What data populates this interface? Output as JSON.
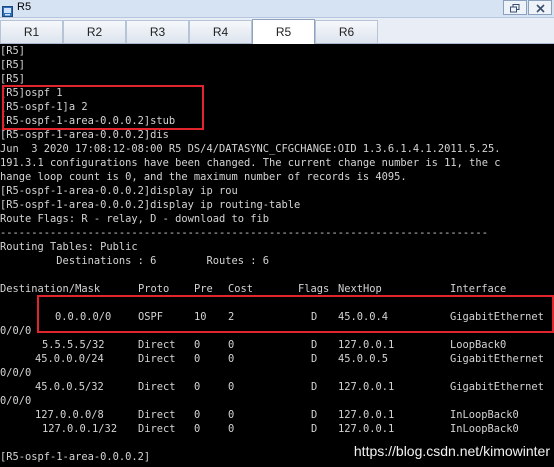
{
  "window": {
    "title": "R5",
    "icon": "router-terminal-icon",
    "buttons": [
      "restore-icon",
      "close-icon"
    ]
  },
  "tabs": [
    {
      "label": "R1",
      "active": false
    },
    {
      "label": "R2",
      "active": false
    },
    {
      "label": "R3",
      "active": false
    },
    {
      "label": "R4",
      "active": false
    },
    {
      "label": "R5",
      "active": true
    },
    {
      "label": "R6",
      "active": false
    }
  ],
  "terminal": {
    "lines": [
      "[R5]",
      "[R5]",
      "[R5]",
      "[R5]ospf 1",
      "[R5-ospf-1]a 2",
      "[R5-ospf-1-area-0.0.0.2]stub",
      "[R5-ospf-1-area-0.0.0.2]dis",
      "Jun  3 2020 17:08:12-08:00 R5 DS/4/DATASYNC_CFGCHANGE:OID 1.3.6.1.4.1.2011.5.25.",
      "191.3.1 configurations have been changed. The current change number is 11, the c",
      "hange loop count is 0, and the maximum number of records is 4095.",
      "[R5-ospf-1-area-0.0.0.2]display ip rou",
      "[R5-ospf-1-area-0.0.0.2]display ip routing-table",
      "Route Flags: R - relay, D - download to fib",
      "------------------------------------------------------------------------------",
      "Routing Tables: Public",
      "         Destinations : 6        Routes : 6"
    ],
    "table": {
      "headers": [
        "Destination/Mask",
        "Proto",
        "Pre",
        "Cost",
        "Flags",
        "NextHop",
        "Interface"
      ],
      "rows": [
        {
          "dest": "0.0.0.0/0",
          "proto": "OSPF",
          "pre": "10",
          "cost": "2",
          "flags": "D",
          "nexthop": "45.0.0.4",
          "iface": "GigabitEthernet",
          "wrap": "0/0/0"
        },
        {
          "dest": "5.5.5.5/32",
          "proto": "Direct",
          "pre": "0",
          "cost": "0",
          "flags": "D",
          "nexthop": "127.0.0.1",
          "iface": "LoopBack0",
          "wrap": ""
        },
        {
          "dest": "45.0.0.0/24",
          "proto": "Direct",
          "pre": "0",
          "cost": "0",
          "flags": "D",
          "nexthop": "45.0.0.5",
          "iface": "GigabitEthernet",
          "wrap": "0/0/0"
        },
        {
          "dest": "45.0.0.5/32",
          "proto": "Direct",
          "pre": "0",
          "cost": "0",
          "flags": "D",
          "nexthop": "127.0.0.1",
          "iface": "GigabitEthernet",
          "wrap": "0/0/0"
        },
        {
          "dest": "127.0.0.0/8",
          "proto": "Direct",
          "pre": "0",
          "cost": "0",
          "flags": "D",
          "nexthop": "127.0.0.1",
          "iface": "InLoopBack0",
          "wrap": ""
        },
        {
          "dest": "127.0.0.1/32",
          "proto": "Direct",
          "pre": "0",
          "cost": "0",
          "flags": "D",
          "nexthop": "127.0.0.1",
          "iface": "InLoopBack0",
          "wrap": ""
        }
      ]
    },
    "prompt": "[R5-ospf-1-area-0.0.0.2]"
  },
  "colors": {
    "terminal_bg": "#000000",
    "terminal_text": "#d4d4d4",
    "highlight": "#e0252d"
  },
  "watermark": "https://blog.csdn.net/kimowinter"
}
